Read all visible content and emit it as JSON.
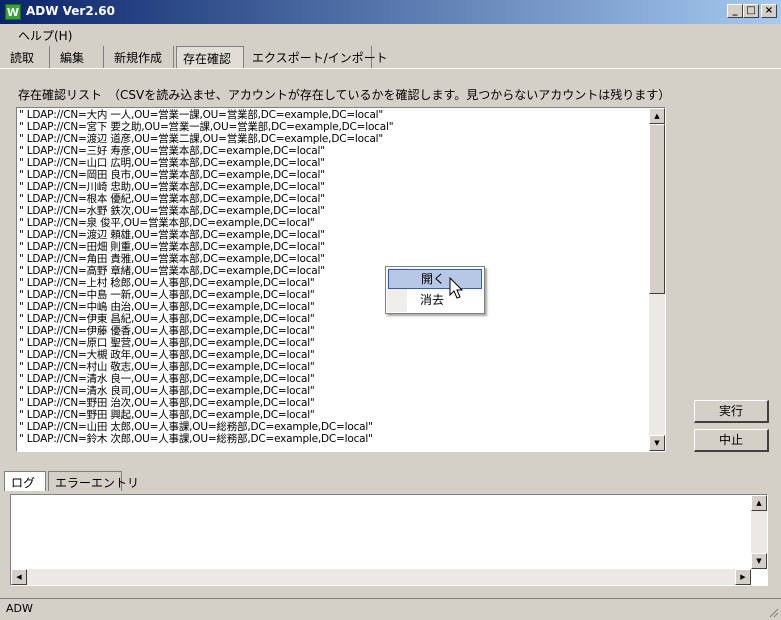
{
  "window": {
    "title": "ADW Ver2.60",
    "app_icon_letter": "W",
    "controls": {
      "minimize": "_",
      "maximize": "□",
      "close": "×"
    }
  },
  "menubar": {
    "help": "ヘルプ(H)"
  },
  "tabs": [
    {
      "label": "読取"
    },
    {
      "label": "編集"
    },
    {
      "label": "新規作成"
    },
    {
      "label": "存在確認"
    },
    {
      "label": "エクスポート/インポート"
    }
  ],
  "main": {
    "list_label": "存在確認リスト　（CSVを読み込ませ、アカウントが存在しているかを確認します。見つからないアカウントは残ります）",
    "list_items": [
      "\" LDAP://CN=大内 一人,OU=営業一課,OU=営業部,DC=example,DC=local\"",
      "\" LDAP://CN=宮下 要之助,OU=営業一課,OU=営業部,DC=example,DC=local\"",
      "\" LDAP://CN=渡辺 道彦,OU=営業二課,OU=営業部,DC=example,DC=local\"",
      "\" LDAP://CN=三好 寿彦,OU=営業本部,DC=example,DC=local\"",
      "\" LDAP://CN=山口 広明,OU=営業本部,DC=example,DC=local\"",
      "\" LDAP://CN=岡田 良市,OU=営業本部,DC=example,DC=local\"",
      "\" LDAP://CN=川崎 忠助,OU=営業本部,DC=example,DC=local\"",
      "\" LDAP://CN=根本 優紀,OU=営業本部,DC=example,DC=local\"",
      "\" LDAP://CN=水野 鉄次,OU=営業本部,DC=example,DC=local\"",
      "\" LDAP://CN=泉 俊平,OU=営業本部,DC=example,DC=local\"",
      "\" LDAP://CN=渡辺 頼雄,OU=営業本部,DC=example,DC=local\"",
      "\" LDAP://CN=田畑 則重,OU=営業本部,DC=example,DC=local\"",
      "\" LDAP://CN=角田 貴雅,OU=営業本部,DC=example,DC=local\"",
      "\" LDAP://CN=高野 章緒,OU=営業本部,DC=example,DC=local\"",
      "\" LDAP://CN=上村 稔郎,OU=人事部,DC=example,DC=local\"",
      "\" LDAP://CN=中島 一新,OU=人事部,DC=example,DC=local\"",
      "\" LDAP://CN=中嶋 由治,OU=人事部,DC=example,DC=local\"",
      "\" LDAP://CN=伊東 昌紀,OU=人事部,DC=example,DC=local\"",
      "\" LDAP://CN=伊藤 優香,OU=人事部,DC=example,DC=local\"",
      "\" LDAP://CN=原口 聖营,OU=人事部,DC=example,DC=local\"",
      "\" LDAP://CN=大槻 政年,OU=人事部,DC=example,DC=local\"",
      "\" LDAP://CN=村山 敬志,OU=人事部,DC=example,DC=local\"",
      "\" LDAP://CN=清水 良一,OU=人事部,DC=example,DC=local\"",
      "\" LDAP://CN=清水 良司,OU=人事部,DC=example,DC=local\"",
      "\" LDAP://CN=野田 治次,OU=人事部,DC=example,DC=local\"",
      "\" LDAP://CN=野田 興起,OU=人事部,DC=example,DC=local\"",
      "\" LDAP://CN=山田 太郎,OU=人事課,OU=総務部,DC=example,DC=local\"",
      "\" LDAP://CN=鈴木 次郎,OU=人事課,OU=総務部,DC=example,DC=local\""
    ],
    "scroll": {
      "up_arrow": "▲",
      "down_arrow": "▼"
    },
    "run_button": "実行",
    "stop_button": "中止"
  },
  "context_menu": {
    "items": [
      {
        "label": "開く"
      },
      {
        "label": "消去"
      }
    ]
  },
  "bottom_tabs": [
    {
      "label": "ログ"
    },
    {
      "label": "エラーエントリ"
    }
  ],
  "log": {
    "scroll": {
      "up_arrow": "▲",
      "down_arrow": "▼",
      "left_arrow": "◀",
      "right_arrow": "▶"
    }
  },
  "statusbar": {
    "text": "ADW"
  },
  "colors": {
    "titlebar_start": "#0a246a",
    "titlebar_end": "#a6caf0",
    "highlight": "#b7c7e6"
  }
}
